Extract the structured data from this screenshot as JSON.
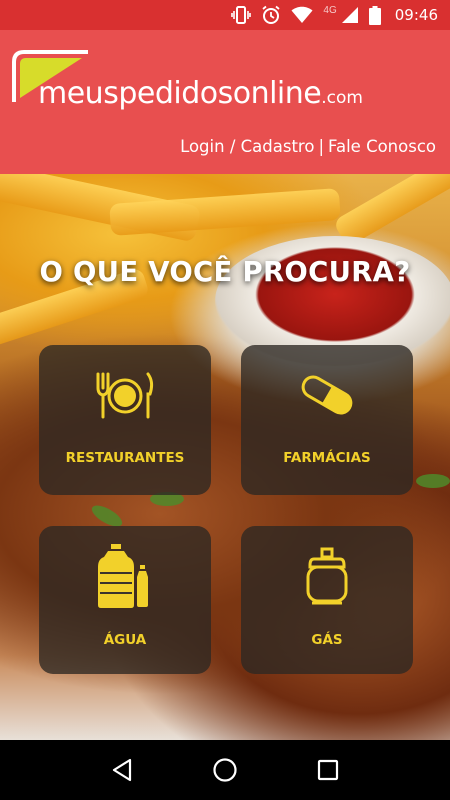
{
  "status_bar": {
    "network_label": "4G",
    "time": "09:46",
    "icons": [
      "vibrate-icon",
      "alarm-icon",
      "wifi-icon",
      "signal-icon",
      "battery-icon"
    ]
  },
  "header": {
    "logo": {
      "text_main": "meuspedidosonline",
      "text_suffix": ".com"
    },
    "links": {
      "login": "Login / Cadastro",
      "separator": "|",
      "contact": "Fale Conosco"
    }
  },
  "hero": {
    "title": "O QUE VOCÊ PROCURA?"
  },
  "categories": [
    {
      "label": "RESTAURANTES",
      "icon": "plate-cutlery-icon"
    },
    {
      "label": "FARMÁCIAS",
      "icon": "pill-icon"
    },
    {
      "label": "ÁGUA",
      "icon": "water-bottle-icon"
    },
    {
      "label": "GÁS",
      "icon": "gas-cylinder-icon"
    }
  ],
  "nav_bar": {
    "icons": [
      "back-icon",
      "home-icon",
      "recents-icon"
    ]
  },
  "colors": {
    "header_red": "#e84f4f",
    "status_red": "#d93030",
    "accent_yellow": "#f2d12a"
  }
}
